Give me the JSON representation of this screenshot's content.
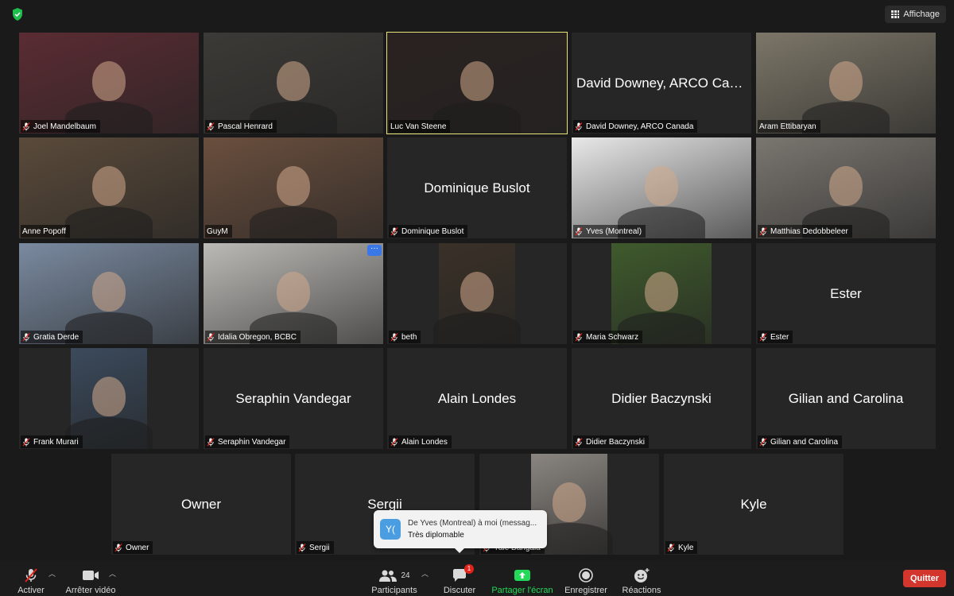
{
  "top": {
    "view_label": "Affichage"
  },
  "tiles": [
    {
      "label": "Joel Mandelbaum",
      "center": "",
      "bg": "#5a2c33"
    },
    {
      "label": "Pascal Henrard",
      "center": "",
      "bg": "#3c3a36"
    },
    {
      "label": "Luc Van Steene",
      "center": "",
      "bg": "#2a2220"
    },
    {
      "label": "David Downey, ARCO Canada",
      "center": "David Downey, ARCO Cana...",
      "bg": ""
    },
    {
      "label": "Aram Ettibaryan",
      "center": "",
      "bg": "#7c7668"
    },
    {
      "label": "Anne Popoff",
      "center": "",
      "bg": "#5a4a3a"
    },
    {
      "label": "GuyM",
      "center": "",
      "bg": "#6a4f3e"
    },
    {
      "label": "Dominique Buslot",
      "center": "Dominique Buslot",
      "bg": ""
    },
    {
      "label": "Yves (Montreal)",
      "center": "",
      "bg": "#e8e8e8"
    },
    {
      "label": "Matthias Dedobbeleer",
      "center": "",
      "bg": "#7a7670"
    },
    {
      "label": "Gratia Derde",
      "center": "",
      "bg": "#7a8aa0"
    },
    {
      "label": "Idalia Obregon, BCBC",
      "center": "",
      "bg": "#bcbab6"
    },
    {
      "label": "beth",
      "center": "",
      "bg": "#3a3128"
    },
    {
      "label": "Maria Schwarz",
      "center": "",
      "bg": "#3f5a2c"
    },
    {
      "label": "Ester",
      "center": "Ester",
      "bg": ""
    },
    {
      "label": "Frank Murari",
      "center": "",
      "bg": "#3b4a5c"
    },
    {
      "label": "Seraphin Vandegar",
      "center": "Seraphin Vandegar",
      "bg": ""
    },
    {
      "label": "Alain Londes",
      "center": "Alain Londes",
      "bg": ""
    },
    {
      "label": "Didier Baczynski",
      "center": "Didier Baczynski",
      "bg": ""
    },
    {
      "label": "Gilian and Carolina",
      "center": "Gilian and Carolina",
      "bg": ""
    },
    {
      "label": "Owner",
      "center": "Owner",
      "bg": ""
    },
    {
      "label": "Sergii",
      "center": "Sergii",
      "bg": ""
    },
    {
      "label": "Yale Bangala",
      "center": "",
      "bg": "#8a8580"
    },
    {
      "label": "Kyle",
      "center": "Kyle",
      "bg": ""
    }
  ],
  "notification": {
    "avatar": "Y(",
    "title": "De Yves (Montreal) à moi (messag...",
    "message": "Très diplomable"
  },
  "toolbar": {
    "mute": "Activer",
    "video": "Arrêter vidéo",
    "participants": "Participants",
    "participants_count": "24",
    "chat": "Discuter",
    "chat_badge": "1",
    "share": "Partager l'écran",
    "record": "Enregistrer",
    "reactions": "Réactions",
    "quit": "Quitter"
  },
  "colors": {
    "active_border": "#e6e57a",
    "share_green": "#23d959",
    "quit_red": "#d3362d",
    "mute_red": "#e2231a"
  }
}
